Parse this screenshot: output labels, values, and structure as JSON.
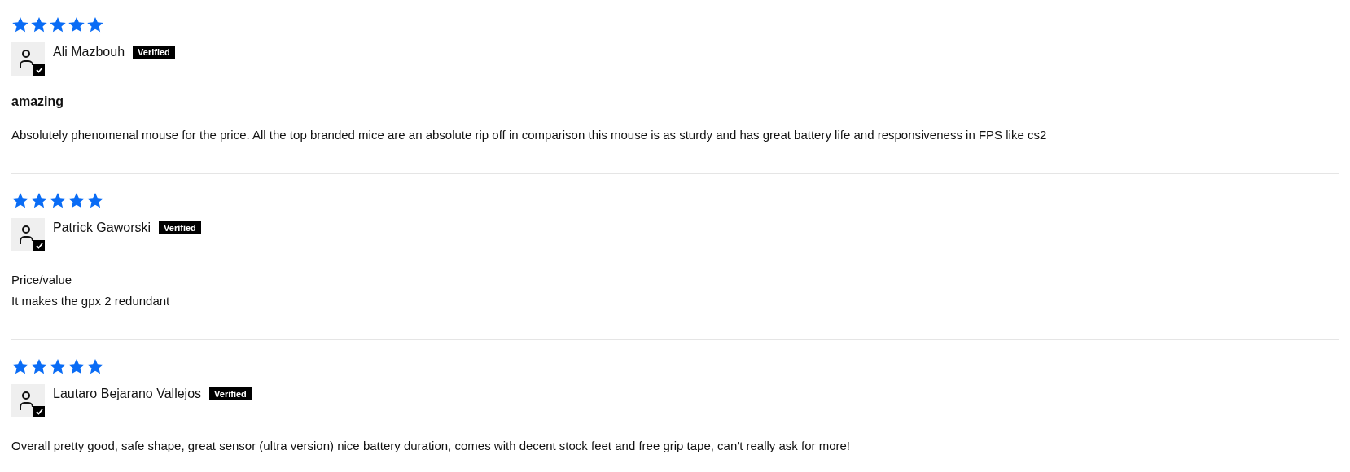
{
  "reviews": [
    {
      "stars": 5,
      "author": "Ali Mazbouh",
      "badge": "Verified",
      "title": "amazing",
      "body_lines": [
        "Absolutely phenomenal mouse for the price. All the top branded mice are an absolute rip off in comparison this mouse is as sturdy and has great battery life and responsiveness in FPS like cs2"
      ]
    },
    {
      "stars": 5,
      "author": "Patrick Gaworski",
      "badge": "Verified",
      "body_lines": [
        "Price/value",
        "It makes the gpx 2 redundant"
      ]
    },
    {
      "stars": 5,
      "author": "Lautaro Bejarano Vallejos",
      "badge": "Verified",
      "body_lines": [
        "Overall pretty good, safe shape, great sensor (ultra version) nice battery duration, comes with decent stock feet and free grip tape, can't really ask for more!"
      ]
    }
  ]
}
